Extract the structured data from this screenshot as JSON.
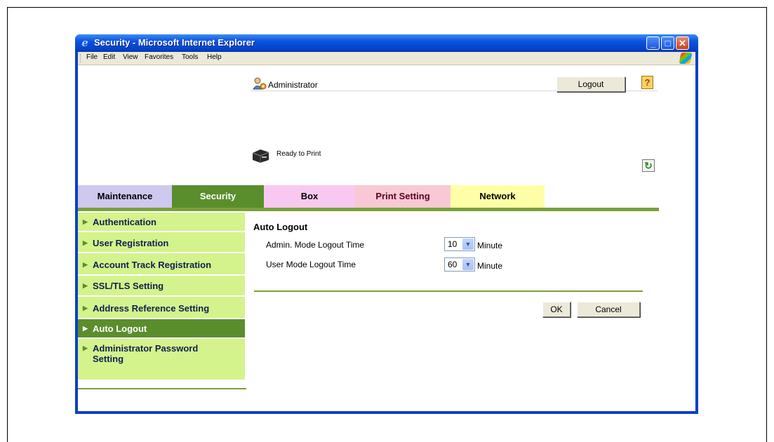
{
  "window": {
    "title": "Security - Microsoft Internet Explorer"
  },
  "menubar": {
    "items": [
      "File",
      "Edit",
      "View",
      "Favorites",
      "Tools",
      "Help"
    ]
  },
  "header": {
    "user_label": "Administrator",
    "logout_label": "Logout",
    "help_label": "?",
    "status_text": "Ready to Print"
  },
  "tabs": [
    {
      "label": "Maintenance"
    },
    {
      "label": "Security"
    },
    {
      "label": "Box"
    },
    {
      "label": "Print Setting"
    },
    {
      "label": "Network"
    }
  ],
  "active_tab": "Security",
  "sidebar": {
    "items": [
      {
        "label": "Authentication"
      },
      {
        "label": "User Registration"
      },
      {
        "label": "Account Track Registration"
      },
      {
        "label": "SSL/TLS Setting"
      },
      {
        "label": "Address Reference Setting"
      },
      {
        "label": "Auto Logout"
      },
      {
        "label": "Administrator Password Setting"
      }
    ],
    "active": "Auto Logout"
  },
  "main": {
    "title": "Auto Logout",
    "fields": [
      {
        "label": "Admin. Mode Logout Time",
        "value": "10",
        "unit": "Minute"
      },
      {
        "label": "User Mode Logout Time",
        "value": "60",
        "unit": "Minute"
      }
    ],
    "ok_label": "OK",
    "cancel_label": "Cancel"
  },
  "colors": {
    "accent_green": "#5a8e2c",
    "sidebar_bg": "#d4f38c",
    "tab_maintenance": "#cfc8ef",
    "tab_box": "#f8c9f0",
    "tab_print": "#f8c9d4",
    "tab_network": "#ffffa8",
    "titlebar_blue": "#0b52e0"
  }
}
